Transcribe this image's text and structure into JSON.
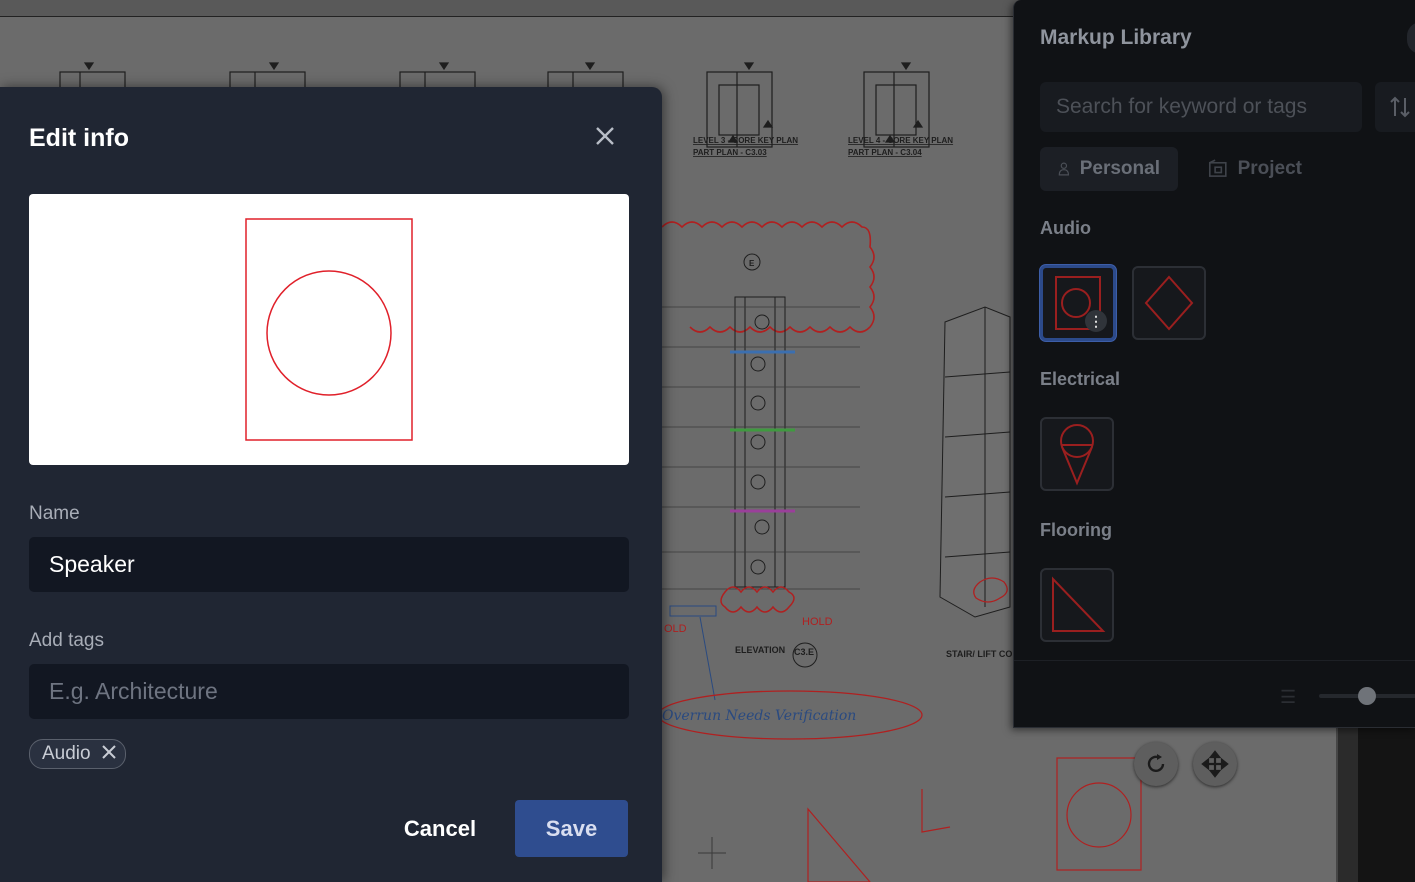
{
  "modal": {
    "title": "Edit info",
    "name_label": "Name",
    "name_value": "Speaker",
    "tags_label": "Add tags",
    "tags_placeholder": "E.g. Architecture",
    "tags": [
      "Audio"
    ],
    "cancel_label": "Cancel",
    "save_label": "Save",
    "preview_color": "#e0202a"
  },
  "library": {
    "title": "Markup Library",
    "search_placeholder": "Search for keyword or tags",
    "tabs": [
      {
        "label": "Personal",
        "icon": "user-icon",
        "active": true
      },
      {
        "label": "Project",
        "icon": "building-icon",
        "active": false
      }
    ],
    "sections": [
      {
        "name": "Audio",
        "items": [
          "rectangle-circle-symbol",
          "diamond-symbol"
        ]
      },
      {
        "name": "Electrical",
        "items": [
          "cone-symbol"
        ]
      },
      {
        "name": "Flooring",
        "items": [
          "triangle-symbol"
        ]
      }
    ]
  },
  "drawing": {
    "plans": [
      {
        "line1": "LEVEL 3 - CORE KEY PLAN",
        "line2": "PART PLAN - C3.03"
      },
      {
        "line1": "LEVEL 4 - CORE KEY PLAN",
        "line2": "PART PLAN - C3.04"
      }
    ],
    "elevation_label": "ELEVATION",
    "elevation_ref": "C3.E",
    "hold_label": "HOLD",
    "hold_label_left": "OLD",
    "annotation": "Overrun Needs Verification",
    "stair_label": "STAIR/ LIFT CO",
    "level_marker": "E"
  }
}
